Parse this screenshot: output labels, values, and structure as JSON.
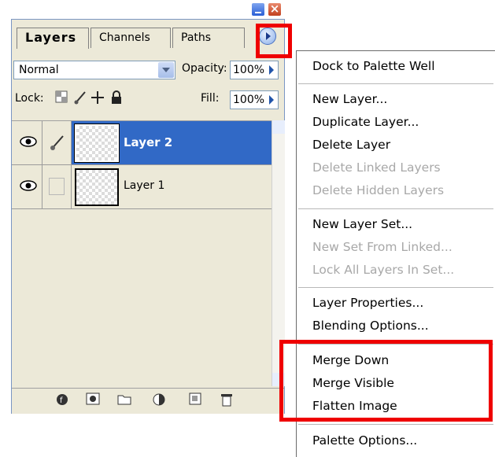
{
  "palette": {
    "tabs": [
      "Layers",
      "Channels",
      "Paths"
    ],
    "blend_mode": "Normal",
    "opacity_label": "Opacity:",
    "opacity_value": "100%",
    "lock_label": "Lock:",
    "fill_label": "Fill:",
    "fill_value": "100%",
    "layers": [
      {
        "name": "Layer 2",
        "selected": true
      },
      {
        "name": "Layer 1",
        "selected": false
      }
    ],
    "icons": {
      "lock": [
        "transparency-lock-icon",
        "brush-lock-icon",
        "move-lock-icon",
        "padlock-icon"
      ],
      "bottom": [
        "layer-style-icon",
        "mask-icon",
        "folder-icon",
        "adjustment-layer-icon",
        "new-layer-icon",
        "trash-icon"
      ]
    }
  },
  "menu": {
    "items": [
      {
        "label": "Dock to Palette Well",
        "enabled": true
      },
      {
        "label": "New Layer...",
        "enabled": true
      },
      {
        "label": "Duplicate Layer...",
        "enabled": true
      },
      {
        "label": "Delete Layer",
        "enabled": true
      },
      {
        "label": "Delete Linked Layers",
        "enabled": false
      },
      {
        "label": "Delete Hidden Layers",
        "enabled": false
      },
      {
        "label": "New Layer Set...",
        "enabled": true
      },
      {
        "label": "New Set From Linked...",
        "enabled": false
      },
      {
        "label": "Lock All Layers In Set...",
        "enabled": false
      },
      {
        "label": "Layer Properties...",
        "enabled": true
      },
      {
        "label": "Blending Options...",
        "enabled": true
      },
      {
        "label": "Merge Down",
        "enabled": true
      },
      {
        "label": "Merge Visible",
        "enabled": true
      },
      {
        "label": "Flatten Image",
        "enabled": true
      },
      {
        "label": "Palette Options...",
        "enabled": true
      }
    ]
  },
  "colors": {
    "highlight": "#ef0000",
    "selection": "#3169c6",
    "panel": "#ece9d8"
  }
}
